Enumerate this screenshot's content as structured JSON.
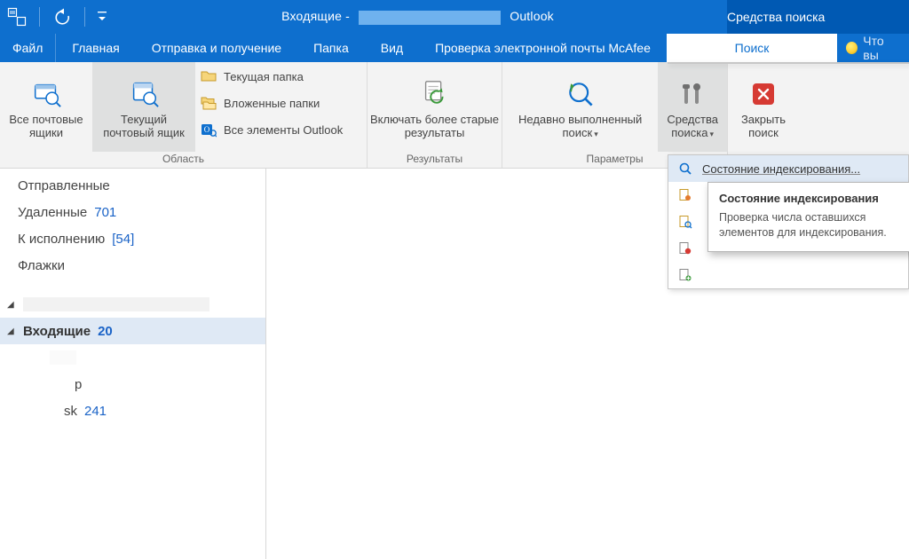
{
  "titlebar": {
    "prefix": "Входящие -",
    "suffix": "Outlook",
    "context_tab": "Средства поиска"
  },
  "menu": {
    "file": "Файл",
    "home": "Главная",
    "sendreceive": "Отправка и получение",
    "folder": "Папка",
    "view": "Вид",
    "mcafee": "Проверка электронной почты McAfee",
    "search": "Поиск",
    "tell_me": "Что вы"
  },
  "ribbon": {
    "scope": {
      "all_mailboxes": "Все почтовые ящики",
      "current_mailbox": "Текущий почтовый ящик",
      "current_folder": "Текущая папка",
      "subfolders": "Вложенные папки",
      "all_outlook": "Все элементы Outlook",
      "group_label": "Область"
    },
    "refine": {
      "include_older": "Включать более старые результаты",
      "group_label": "Результаты"
    },
    "options": {
      "recent": "Недавно выполненный поиск",
      "tools": "Средства поиска",
      "group_label": "Параметры"
    },
    "close": {
      "close_search": "Закрыть поиск"
    }
  },
  "dropdown": {
    "indexing_status": "Состояние индексирования...",
    "tooltip_title": "Состояние индексирования",
    "tooltip_body": "Проверка числа оставшихся элементов для индексирования."
  },
  "nav": {
    "sent": "Отправленные",
    "deleted": "Удаленные",
    "deleted_count": "701",
    "todo": "К исполнению",
    "todo_count": "[54]",
    "flags": "Флажки",
    "inbox": "Входящие",
    "inbox_count": "20",
    "sub_p_suffix": "р",
    "sub_sk_suffix": "sk",
    "sub_sk_count": "241"
  }
}
